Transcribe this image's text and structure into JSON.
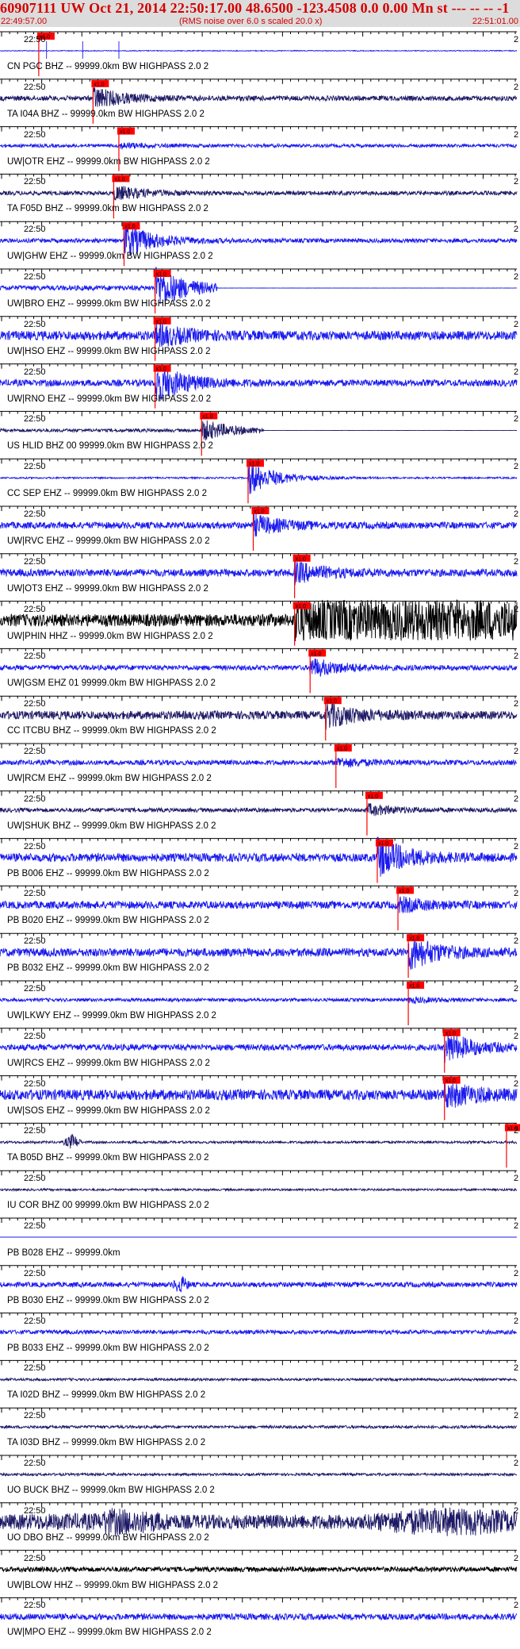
{
  "header": {
    "title": "60907111 UW Oct 21, 2014 22:50:17.00   48.6500  -123.4508   0.0  0.00  Mn st --- -- --   -1",
    "time_start": "22:49:57.00",
    "time_end": "22:51:01.00",
    "rms_note": "(RMS noise over 6.0 s scaled 20.0 x)",
    "minute_tick_label": "22:50",
    "right_edge_label": "2",
    "pick_label": "x1.0"
  },
  "colors": {
    "title": "#d40000",
    "header_bg": "#dcdcdc",
    "pick_line": "#ff0000",
    "pick_box": "#ff0000",
    "trace_blue": "#1a1aee",
    "trace_navy": "#1e1a66",
    "trace_black": "#000000"
  },
  "traces": [
    {
      "label": "CN PGC BHZ -- 99999.0km BW  HIGHPASS  2.0  2",
      "color": "trace_blue",
      "pick": 0.075,
      "amp": 0.02,
      "event_amp": 0.0,
      "spikes": true
    },
    {
      "label": "TA I04A BHZ -- 99999.0km BW  HIGHPASS  2.0  2",
      "color": "trace_navy",
      "pick": 0.18,
      "amp": 0.12,
      "event_amp": 0.5
    },
    {
      "label": "UW|OTR EHZ -- 99999.0km BW  HIGHPASS  2.0  2",
      "color": "trace_blue",
      "pick": 0.23,
      "amp": 0.08,
      "event_amp": 0.12
    },
    {
      "label": "TA F05D BHZ -- 99999.0km BW  HIGHPASS  2.0  2",
      "color": "trace_navy",
      "pick": 0.22,
      "amp": 0.1,
      "event_amp": 0.35
    },
    {
      "label": "UW|GHW EHZ -- 99999.0km BW  HIGHPASS  2.0  2",
      "color": "trace_blue",
      "pick": 0.24,
      "amp": 0.1,
      "event_amp": 0.8
    },
    {
      "label": "UW|BRO EHZ -- 99999.0km BW  HIGHPASS  2.0  2",
      "color": "trace_blue",
      "pick": 0.3,
      "amp": 0.12,
      "event_amp": 1.0,
      "dead_after": true
    },
    {
      "label": "UW|HSO EHZ -- 99999.0km BW  HIGHPASS  2.0  2",
      "color": "trace_blue",
      "pick": 0.3,
      "amp": 0.22,
      "event_amp": 0.5
    },
    {
      "label": "UW|RNO EHZ -- 99999.0km BW  HIGHPASS  2.0  2",
      "color": "trace_blue",
      "pick": 0.3,
      "amp": 0.16,
      "event_amp": 0.9
    },
    {
      "label": "US HLID BHZ 00 99999.0km BW  HIGHPASS  2.0  2",
      "color": "trace_navy",
      "pick": 0.39,
      "amp": 0.08,
      "event_amp": 0.5,
      "dead_after": true
    },
    {
      "label": "CC SEP EHZ -- 99999.0km BW  HIGHPASS  2.0  2",
      "color": "trace_blue",
      "pick": 0.48,
      "amp": 0.04,
      "event_amp": 0.8
    },
    {
      "label": "UW|RVC EHZ -- 99999.0km BW  HIGHPASS  2.0  2",
      "color": "trace_blue",
      "pick": 0.49,
      "amp": 0.16,
      "event_amp": 0.45
    },
    {
      "label": "UW|OT3 EHZ -- 99999.0km BW  HIGHPASS  2.0  2",
      "color": "trace_blue",
      "pick": 0.57,
      "amp": 0.18,
      "event_amp": 0.45
    },
    {
      "label": "UW|PHIN HHZ -- 99999.0km BW  HIGHPASS  2.0  2",
      "color": "trace_black",
      "pick": 0.57,
      "amp": 0.3,
      "event_amp": 1.0,
      "saturate": true
    },
    {
      "label": "UW|GSM EHZ 01 99999.0km BW  HIGHPASS  2.0  2",
      "color": "trace_blue",
      "pick": 0.6,
      "amp": 0.12,
      "event_amp": 0.45
    },
    {
      "label": "CC ITCBU BHZ -- 99999.0km BW  HIGHPASS  2.0  2",
      "color": "trace_navy",
      "pick": 0.63,
      "amp": 0.2,
      "event_amp": 0.55
    },
    {
      "label": "UW|RCM EHZ -- 99999.0km BW  HIGHPASS  2.0  2",
      "color": "trace_blue",
      "pick": 0.65,
      "amp": 0.12,
      "event_amp": 0.2
    },
    {
      "label": "UW|SHUK BHZ -- 99999.0km BW  HIGHPASS  2.0  2",
      "color": "trace_navy",
      "pick": 0.71,
      "amp": 0.1,
      "event_amp": 0.25
    },
    {
      "label": "PB B006 EHZ -- 99999.0km BW  HIGHPASS  2.0  2",
      "color": "trace_blue",
      "pick": 0.73,
      "amp": 0.2,
      "event_amp": 0.9
    },
    {
      "label": "PB B020 EHZ -- 99999.0km BW  HIGHPASS  2.0  2",
      "color": "trace_blue",
      "pick": 0.77,
      "amp": 0.18,
      "event_amp": 0.3
    },
    {
      "label": "PB B032 EHZ -- 99999.0km BW  HIGHPASS  2.0  2",
      "color": "trace_blue",
      "pick": 0.79,
      "amp": 0.2,
      "event_amp": 0.75
    },
    {
      "label": "UW|LKWY EHZ -- 99999.0km BW  HIGHPASS  2.0  2",
      "color": "trace_blue",
      "pick": 0.79,
      "amp": 0.08,
      "event_amp": 0.12
    },
    {
      "label": "UW|RCS EHZ -- 99999.0km BW  HIGHPASS  2.0  2",
      "color": "trace_blue",
      "pick": 0.86,
      "amp": 0.15,
      "event_amp": 0.7
    },
    {
      "label": "UW|SOS EHZ -- 99999.0km BW  HIGHPASS  2.0  2",
      "color": "trace_blue",
      "pick": 0.86,
      "amp": 0.25,
      "event_amp": 0.55
    },
    {
      "label": "TA B05D BHZ -- 99999.0km BW  HIGHPASS  2.0  2",
      "color": "trace_navy",
      "pick": 0.98,
      "amp": 0.06,
      "event_amp": 0.0,
      "blip": 0.14
    },
    {
      "label": "IU COR BHZ 00 99999.0km BW  HIGHPASS  2.0  2",
      "color": "trace_navy",
      "pick": null,
      "amp": 0.05,
      "event_amp": 0.0
    },
    {
      "label": "PB B028 EHZ -- 99999.0km",
      "color": "trace_blue",
      "pick": null,
      "amp": 0.0,
      "event_amp": 0.0
    },
    {
      "label": "PB B030 EHZ -- 99999.0km BW  HIGHPASS  2.0  2",
      "color": "trace_blue",
      "pick": null,
      "amp": 0.12,
      "event_amp": 0.0,
      "blip": 0.35
    },
    {
      "label": "PB B033 EHZ -- 99999.0km BW  HIGHPASS  2.0  2",
      "color": "trace_blue",
      "pick": null,
      "amp": 0.1,
      "event_amp": 0.0
    },
    {
      "label": "TA I02D BHZ -- 99999.0km BW  HIGHPASS  2.0  2",
      "color": "trace_navy",
      "pick": null,
      "amp": 0.06,
      "event_amp": 0.0
    },
    {
      "label": "TA I03D BHZ -- 99999.0km BW  HIGHPASS  2.0  2",
      "color": "trace_navy",
      "pick": null,
      "amp": 0.07,
      "event_amp": 0.0
    },
    {
      "label": "UO BUCK BHZ -- 99999.0km BW  HIGHPASS  2.0  2",
      "color": "trace_navy",
      "pick": null,
      "amp": 0.06,
      "event_amp": 0.0
    },
    {
      "label": "UO DBO BHZ -- 99999.0km BW  HIGHPASS  2.0  2",
      "color": "trace_navy",
      "pick": null,
      "amp": 0.35,
      "event_amp": 0.0,
      "noisy": true
    },
    {
      "label": "UW|BLOW HHZ -- 99999.0km BW  HIGHPASS  2.0  2",
      "color": "trace_black",
      "pick": null,
      "amp": 0.12,
      "event_amp": 0.0
    },
    {
      "label": "UW|MPO EHZ -- 99999.0km BW  HIGHPASS  2.0  2",
      "color": "trace_blue",
      "pick": null,
      "amp": 0.15,
      "event_amp": 0.0
    }
  ]
}
